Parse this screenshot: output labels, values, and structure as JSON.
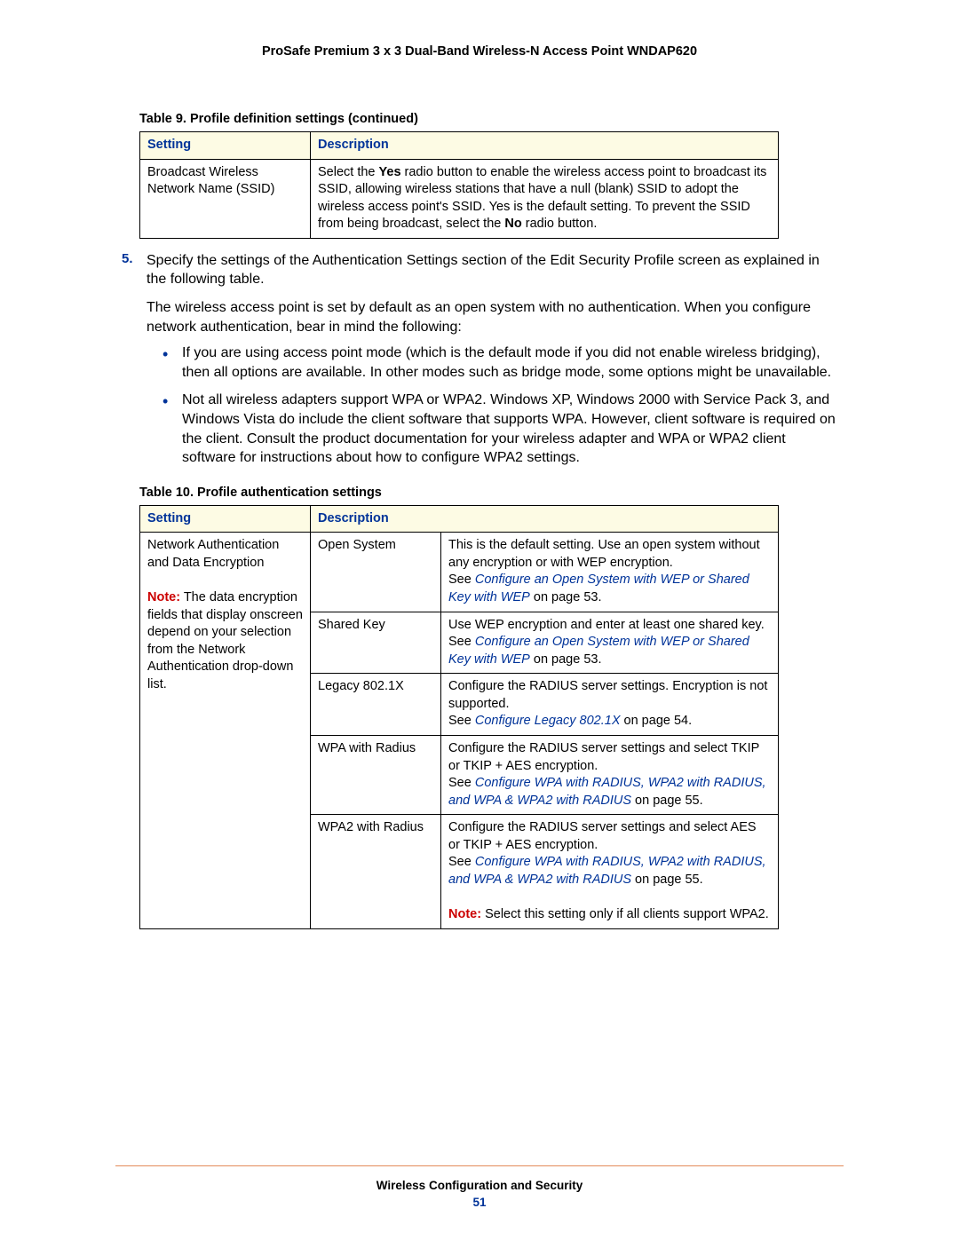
{
  "header": {
    "title": "ProSafe Premium 3 x 3 Dual-Band Wireless-N Access Point WNDAP620"
  },
  "table9": {
    "caption": "Table 9.  Profile definition settings (continued)",
    "head_setting": "Setting",
    "head_description": "Description",
    "row1_setting": "Broadcast Wireless Network Name (SSID)",
    "row1_desc_pre": "Select the ",
    "row1_desc_yes": "Yes",
    "row1_desc_mid": " radio button to enable the wireless access point to broadcast its SSID, allowing wireless stations that have a null (blank) SSID to adopt the wireless access point's SSID. Yes is the default setting. To prevent the SSID from being broadcast, select the ",
    "row1_desc_no": "No",
    "row1_desc_post": " radio button."
  },
  "step5": {
    "num": "5.",
    "text": "Specify the settings of the Authentication Settings section of the Edit Security Profile screen as explained in the following table."
  },
  "para1": "The wireless access point is set by default as an open system with no authentication. When you configure network authentication, bear in mind the following:",
  "bullets": {
    "b1": "If you are using access point mode (which is the default mode if you did not enable wireless bridging), then all options are available. In other modes such as bridge mode, some options might be unavailable.",
    "b2": "Not all wireless adapters support WPA or WPA2. Windows XP, Windows 2000 with Service Pack 3, and Windows Vista do include the client software that supports WPA. However, client software is required on the client. Consult the product documentation for your wireless adapter and WPA or WPA2 client software for instructions about how to configure WPA2 settings."
  },
  "table10": {
    "caption": "Table 10.  Profile authentication settings",
    "head_setting": "Setting",
    "head_description": "Description",
    "cell_setting_p1": "Network Authentication and Data Encryption",
    "cell_setting_note_label": "Note:",
    "cell_setting_note_text": "  The data encryption fields that display onscreen depend on your selection from the Network Authentication drop-down list.",
    "rows": [
      {
        "method": "Open System",
        "desc_p1": "This is the default setting. Use an open system without any encryption or with WEP encryption.",
        "see_prefix": "See ",
        "link_text": "Configure an Open System with WEP or Shared Key with WEP",
        "see_suffix": " on page 53."
      },
      {
        "method": "Shared Key",
        "desc_p1": "Use WEP encryption and enter at least one shared key.",
        "see_prefix": "See ",
        "link_text": "Configure an Open System with WEP or Shared Key with WEP",
        "see_suffix": " on page 53."
      },
      {
        "method": "Legacy 802.1X",
        "desc_p1": "Configure the RADIUS server settings. Encryption is not supported.",
        "see_prefix": "See ",
        "link_text": "Configure Legacy 802.1X",
        "see_suffix": " on page 54."
      },
      {
        "method": "WPA with Radius",
        "desc_p1": "Configure the RADIUS server settings and select TKIP or TKIP + AES encryption.",
        "see_prefix": "See ",
        "link_text": "Configure WPA with RADIUS, WPA2 with RADIUS, and WPA & WPA2 with RADIUS",
        "see_suffix": " on page 55."
      },
      {
        "method": "WPA2 with Radius",
        "desc_p1": "Configure the RADIUS server settings and select AES or TKIP + AES encryption.",
        "see_prefix": "See ",
        "link_text": "Configure WPA with RADIUS, WPA2 with RADIUS, and WPA & WPA2 with RADIUS",
        "see_suffix": " on page 55.",
        "note_label": "Note:",
        "note_text": "  Select this setting only if all clients support WPA2."
      }
    ]
  },
  "footer": {
    "section": "Wireless Configuration and Security",
    "page": "51"
  }
}
